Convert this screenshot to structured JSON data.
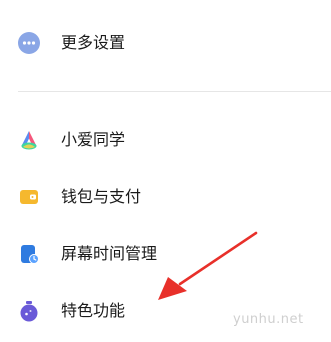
{
  "settings": {
    "items": [
      {
        "label": "更多设置",
        "icon": "more-dots-icon"
      },
      {
        "label": "小爱同学",
        "icon": "xiaoai-assistant-icon"
      },
      {
        "label": "钱包与支付",
        "icon": "wallet-icon"
      },
      {
        "label": "屏幕时间管理",
        "icon": "screen-time-icon"
      },
      {
        "label": "特色功能",
        "icon": "special-features-icon"
      }
    ]
  },
  "watermark": "yunhu.net",
  "colors": {
    "arrow": "#e8302a",
    "more_settings_icon": "#8aa6e6",
    "wallet_icon": "#f5b82e",
    "screen_time_icon": "#2f7be0",
    "special_features_icon": "#6a5ad8"
  }
}
